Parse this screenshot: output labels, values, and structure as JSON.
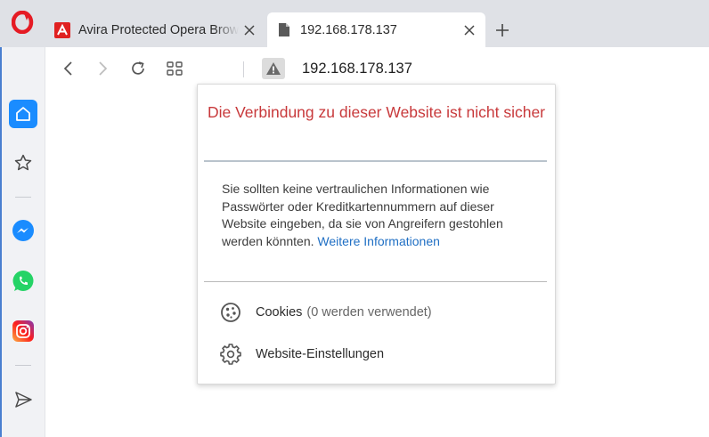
{
  "colors": {
    "tabstrip_bg": "#dfe1e6",
    "sidebar_bg": "#f1f2f5",
    "home_accent": "#1a8cff",
    "warning_title": "#c8393b",
    "link": "#1f6fc4",
    "opera_red": "#e51b24"
  },
  "browser": {
    "logo_icon": "opera-logo-icon"
  },
  "tabs": [
    {
      "title": "Avira Protected Opera Brow",
      "favicon": "avira-icon",
      "active": false
    },
    {
      "title": "192.168.178.137",
      "favicon": "document-icon",
      "active": true
    }
  ],
  "sidebar": {
    "items": [
      {
        "icon": "home-icon",
        "active": true
      },
      {
        "icon": "star-icon"
      },
      {
        "icon": "messenger-icon"
      },
      {
        "icon": "whatsapp-icon"
      },
      {
        "icon": "instagram-icon"
      },
      {
        "icon": "send-icon"
      }
    ]
  },
  "addressbar": {
    "url": "192.168.178.137",
    "security_icon": "warning-icon"
  },
  "popup": {
    "title": "Die Verbindung zu dieser Website ist nicht sicher",
    "body": "Sie sollten keine vertraulichen Informationen wie Passwörter oder Kreditkartennummern auf dieser Website eingeben, da sie von Angreifern gestohlen werden könnten.",
    "link": "Weitere Informationen",
    "cookies_label": "Cookies",
    "cookies_count": "(0 werden verwendet)",
    "settings_label": "Website-Einstellungen"
  }
}
